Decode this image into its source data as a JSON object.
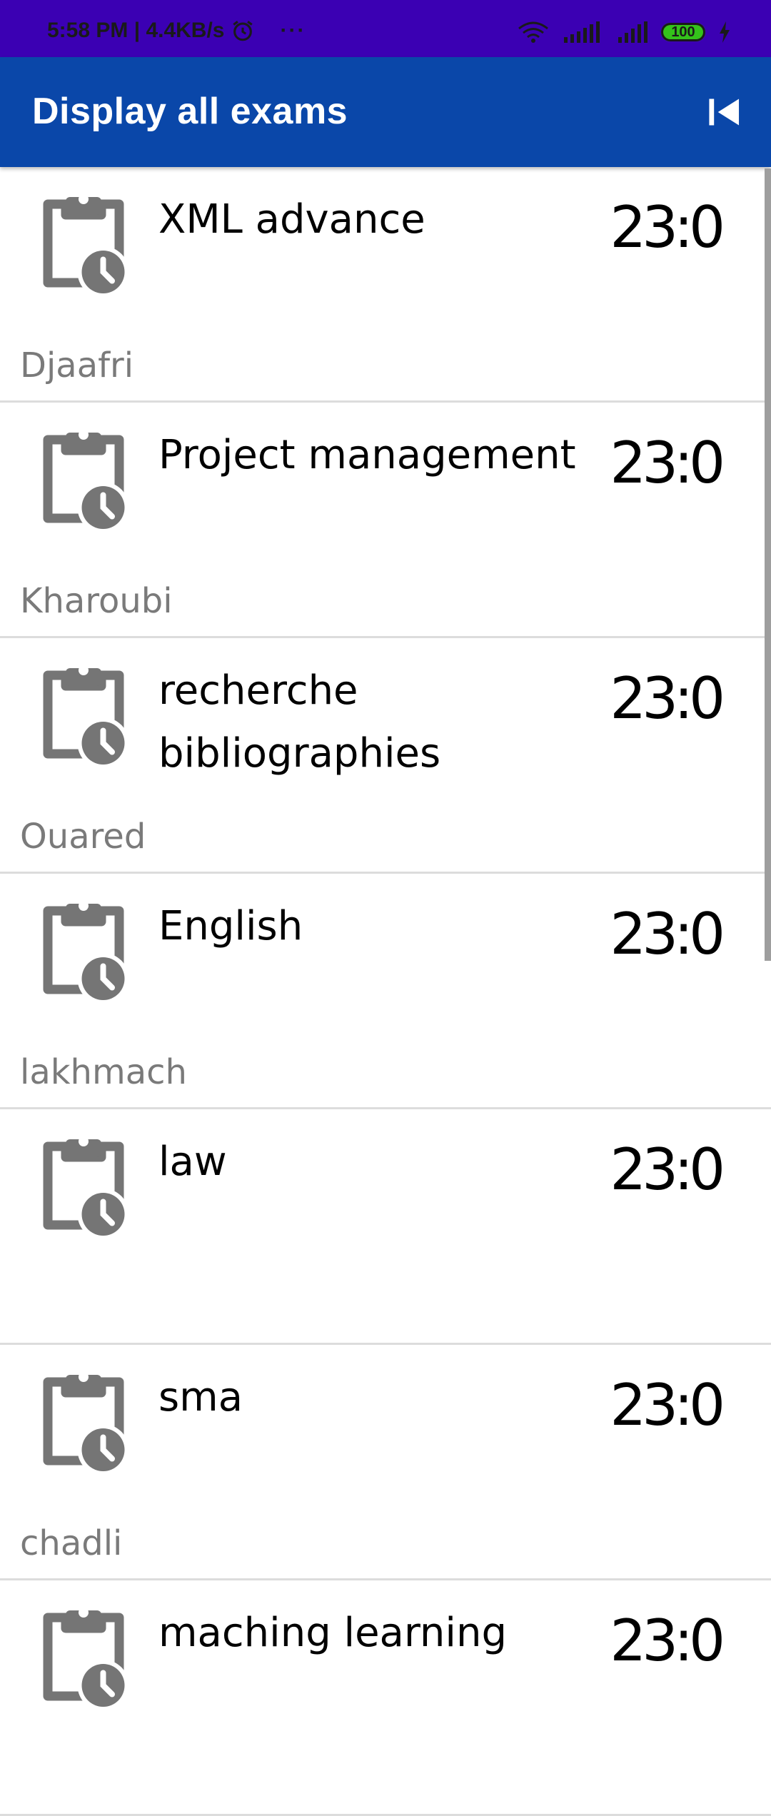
{
  "status_bar": {
    "time_speed": "5:58 PM | 4.4KB/s",
    "more": "···",
    "battery": "100",
    "bg_color": "#3b00b3"
  },
  "app_bar": {
    "title": "Display all exams",
    "first_page_icon": "first-page-icon",
    "bg_color": "#0a47a9"
  },
  "exams": [
    {
      "subject": "XML advance",
      "time": "23:0",
      "teacher": "Djaafri"
    },
    {
      "subject": "Project management",
      "time": "23:0",
      "teacher": "Kharoubi"
    },
    {
      "subject": "recherche bibliographies",
      "time": "23:0",
      "teacher": "Ouared"
    },
    {
      "subject": "English",
      "time": "23:0",
      "teacher": "lakhmach"
    },
    {
      "subject": "law",
      "time": "23:0",
      "teacher": ""
    },
    {
      "subject": "sma",
      "time": "23:0",
      "teacher": "chadli"
    },
    {
      "subject": "maching learning",
      "time": "23:0",
      "teacher": ""
    }
  ],
  "icon_name": "clipboard-clock-icon",
  "icon_color": "#757575"
}
